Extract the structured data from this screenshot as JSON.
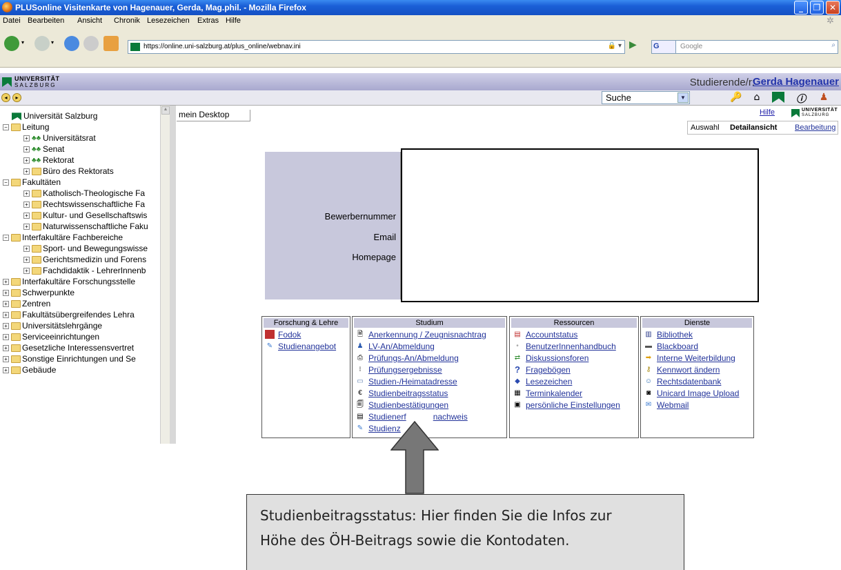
{
  "window": {
    "title": "PLUSonline Visitenkarte von Hagenauer, Gerda, Mag.phil. - Mozilla Firefox"
  },
  "menubar": {
    "items": [
      "Datei",
      "Bearbeiten",
      "Ansicht",
      "Chronik",
      "Lesezeichen",
      "Extras",
      "Hilfe"
    ]
  },
  "navbar": {
    "url": "https://online.uni-salzburg.at/plus_online/webnav.ini",
    "search_placeholder": "Google",
    "search_engine_label": "G"
  },
  "header": {
    "logo_line1": "UNIVERSITÄT",
    "logo_line2": "SALZBURG",
    "role_label": "Studierende/r:",
    "user_name": "Gerda Hagenauer"
  },
  "toolbar": {
    "search_select": "Suche"
  },
  "tree": {
    "root": "Universität Salzburg",
    "nodes": [
      {
        "label": "Leitung"
      },
      {
        "label": "Universitätsrat"
      },
      {
        "label": "Senat"
      },
      {
        "label": "Rektorat"
      },
      {
        "label": "Büro des Rektorats"
      },
      {
        "label": "Fakultäten"
      },
      {
        "label": "Katholisch-Theologische Fa"
      },
      {
        "label": "Rechtswissenschaftliche Fa"
      },
      {
        "label": "Kultur- und Gesellschaftswis"
      },
      {
        "label": "Naturwissenschaftliche Faku"
      },
      {
        "label": "Interfakultäre Fachbereiche"
      },
      {
        "label": "Sport- und Bewegungswisse"
      },
      {
        "label": "Gerichtsmedizin und Forens"
      },
      {
        "label": "Fachdidaktik - LehrerInnenb"
      },
      {
        "label": "Interfakultäre Forschungsstelle"
      },
      {
        "label": "Schwerpunkte"
      },
      {
        "label": "Zentren"
      },
      {
        "label": "Fakultätsübergreifendes Lehra"
      },
      {
        "label": "Universitätslehrgänge"
      },
      {
        "label": "Serviceeinrichtungen"
      },
      {
        "label": "Gesetzliche Interessensvertret"
      },
      {
        "label": "Sonstige Einrichtungen und Se"
      },
      {
        "label": "Gebäude"
      }
    ]
  },
  "main": {
    "desktop_tab": "mein Desktop",
    "help_link": "Hilfe",
    "view_tabs": {
      "select": "Auswahl",
      "detail": "Detailansicht",
      "edit": "Bearbeitung"
    },
    "card_labels": {
      "applicant_no": "Bewerbernummer",
      "email": "Email",
      "homepage": "Homepage"
    }
  },
  "boxes": {
    "forschung": {
      "title": "Forschung & Lehre",
      "items": [
        "Fodok",
        "Studienangebot"
      ]
    },
    "studium": {
      "title": "Studium",
      "items": [
        "Anerkennung / Zeugnisnachtrag",
        "LV-An/Abmeldung",
        "Prüfungs-An/Abmeldung",
        "Prüfungsergebnisse",
        "Studien-/Heimatadresse",
        "Studienbeitragsstatus",
        "Studienbestätigungen",
        "Studienerf",
        "nachweis",
        "Studienz"
      ]
    },
    "ressourcen": {
      "title": "Ressourcen",
      "items": [
        "Accountstatus",
        "BenutzerInnenhandbuch",
        "Diskussionsforen",
        "Fragebögen",
        "Lesezeichen",
        "Terminkalender",
        "persönliche Einstellungen"
      ]
    },
    "dienste": {
      "title": "Dienste",
      "items": [
        "Bibliothek",
        "Blackboard",
        "Interne Weiterbildung",
        "Kennwort ändern",
        "Rechtsdatenbank",
        "Unicard Image Upload",
        "Webmail"
      ]
    }
  },
  "callout": {
    "line1": "Studienbeitragsstatus: Hier finden Sie die Infos  zur",
    "line2": "Höhe des ÖH-Beitrags sowie die Kontodaten."
  }
}
